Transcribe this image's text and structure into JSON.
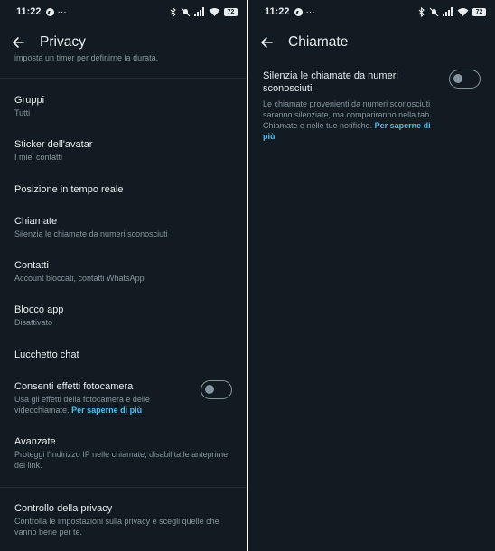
{
  "left": {
    "status": {
      "time": "11:22",
      "dots": "···",
      "battery": "72"
    },
    "appbar": {
      "title": "Privacy"
    },
    "cutoff_text": "imposta un timer per definirne la durata.",
    "items": [
      {
        "title": "Gruppi",
        "subtitle": "Tutti"
      },
      {
        "title": "Sticker dell'avatar",
        "subtitle": "I miei contatti"
      },
      {
        "title": "Posizione in tempo reale"
      },
      {
        "title": "Chiamate",
        "subtitle": "Silenzia le chiamate da numeri sconosciuti"
      },
      {
        "title": "Contatti",
        "subtitle": "Account bloccati, contatti WhatsApp"
      },
      {
        "title": "Blocco app",
        "subtitle": "Disattivato"
      },
      {
        "title": "Lucchetto chat"
      },
      {
        "title": "Consenti effetti fotocamera",
        "subtitle": "Usa gli effetti della fotocamera e delle videochiamate.",
        "link": "Per saperne di più",
        "toggle_on": false
      },
      {
        "title": "Avanzate",
        "subtitle": "Proteggi l'indirizzo IP nelle chiamate, disabilita le anteprime dei link."
      },
      {
        "title": "Controllo della privacy",
        "subtitle": "Controlla le impostazioni sulla privacy e scegli quelle che vanno bene per te."
      }
    ]
  },
  "right": {
    "status": {
      "time": "11:22",
      "dots": "···",
      "battery": "72"
    },
    "appbar": {
      "title": "Chiamate"
    },
    "setting": {
      "title": "Silenzia le chiamate da numeri sconosciuti",
      "description": "Le chiamate provenienti da numeri sconosciuti saranno silenziate, ma compariranno nella tab Chiamate e nelle tue notifiche.",
      "link": "Per saperne di più",
      "toggle_on": false
    }
  },
  "colors": {
    "background": "#111b21",
    "text": "#e9edef",
    "secondary": "#8696a0",
    "link": "#53bdeb"
  }
}
